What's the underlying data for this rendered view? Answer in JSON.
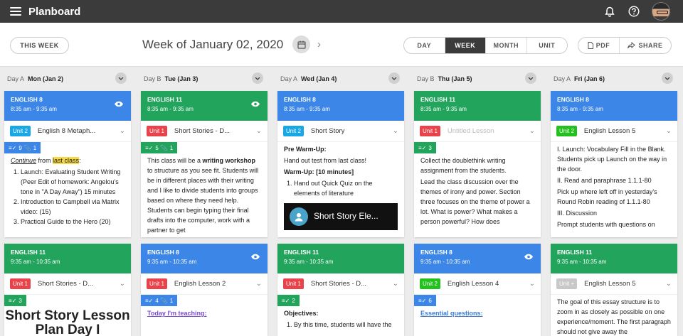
{
  "app": {
    "title": "Planboard"
  },
  "toolbar": {
    "this_week": "THIS WEEK",
    "week_title": "Week of January 02, 2020",
    "views": [
      "DAY",
      "WEEK",
      "MONTH",
      "UNIT"
    ],
    "active_view": "WEEK",
    "pdf": "PDF",
    "share": "SHARE"
  },
  "colors": {
    "blue": "#3b86e6",
    "green": "#22a45d",
    "red": "#e8434b",
    "unit_blue": "#1aa7e6",
    "unit_green": "#24c01d",
    "unit_gray": "#c8c8c8",
    "tab_blue": "#3b86e6",
    "tab_green": "#22a45d"
  },
  "days": [
    {
      "letter": "Day A",
      "name": "Mon (Jan 2)"
    },
    {
      "letter": "Day B",
      "name": "Tue (Jan 3)"
    },
    {
      "letter": "Day A",
      "name": "Wed (Jan 4)"
    },
    {
      "letter": "Day B",
      "name": "Thu (Jan 5)"
    },
    {
      "letter": "Day A",
      "name": "Fri (Jan 6)"
    }
  ],
  "cards": {
    "mon1": {
      "class": "ENGLISH 8",
      "time": "8:35 am - 9:35 am",
      "unit": "Unit 2",
      "lesson": "English 8 Metaph...",
      "checks": "9",
      "clips": "1",
      "intro_a": "Continue",
      "intro_b": " from ",
      "intro_c": "last class",
      "intro_d": ":",
      "items": [
        "Launch: Evaluating Student Writing (Peer Edit of homework: Angelou's tone in \"A Day Away\") 15 minutes",
        "Introduction to Campbell via Matrix video: (15)",
        "Practical Guide to the Hero (20)"
      ]
    },
    "tue1": {
      "class": "ENGLISH 11",
      "time": "8:35 am - 9:35 am",
      "unit": "Unit 1",
      "lesson": "Short Stories - D...",
      "checks": "5",
      "clips": "1",
      "text_a": "This class will be a ",
      "text_b": "writing workshop",
      "text_c": " to structure as you see fit. Students will be in different places with their writing and I like to divide students into groups based on where they need help. Students can begin typing their final drafts into the computer, work with a partner to get"
    },
    "wed1": {
      "class": "ENGLISH 8",
      "time": "8:35 am - 9:35 am",
      "unit": "Unit 2",
      "lesson": "Short Story",
      "h1": "Pre Warm-Up:",
      "p1": "Hand out test from last class!",
      "h2": "Warm-Up: [10 minutes]",
      "items": [
        "Hand out Quick Quiz on the elements of literature"
      ],
      "video": "Short Story Ele..."
    },
    "thu1": {
      "class": "ENGLISH 11",
      "time": "8:35 am - 9:35 am",
      "unit": "Unit 1",
      "lesson": "Untitled Lesson",
      "checks": "3",
      "p1": "Collect the doublethink writing assignment from the students.",
      "p2": "Lead the class discussion over the themes of irony and power. Section three focuses on the theme of power a lot. What is power? What makes a person powerful? How does"
    },
    "fri1": {
      "class": "ENGLISH 8",
      "time": "8:35 am - 9:35 am",
      "unit": "Unit 2",
      "lesson": "English Lesson 5",
      "p1": "I. Launch: Vocabulary Fill in the Blank. Students pick up Launch on the way in the door.",
      "p2": "II. Read and paraphrase 1.1.1-80",
      "p3": "Pick up where left off in yesterday's Round Robin reading of 1.1.1-80",
      "p4": "III. Discussion",
      "p5": "Prompt students with questions on"
    },
    "mon2": {
      "class": "ENGLISH 11",
      "time": "9:35 am - 10:35 am",
      "unit": "Unit 1",
      "lesson": "Short Stories - D...",
      "checks": "3",
      "big": "Short Story Lesson Plan Day I"
    },
    "tue2": {
      "class": "ENGLISH 8",
      "time": "9:35 am - 10:35 am",
      "unit": "Unit 1",
      "lesson": "English Lesson 2",
      "checks": "4",
      "clips": "1",
      "link": "Today I'm teaching:"
    },
    "wed2": {
      "class": "ENGLISH 11",
      "time": "9:35 am - 10:35 am",
      "unit": "Unit 1",
      "lesson": "Short Stories - D...",
      "checks": "2",
      "h1": "Objectives:",
      "items": [
        "By this time, students will have the"
      ]
    },
    "thu2": {
      "class": "ENGLISH 8",
      "time": "9:35 am - 10:35 am",
      "unit": "Unit 2",
      "lesson": "English Lesson 4",
      "checks": "6",
      "link": "Essential questions:"
    },
    "fri2": {
      "class": "ENGLISH 11",
      "time": "9:35 am - 10:35 am",
      "unit": "Unit",
      "lesson": "English Lesson 5",
      "p1": "The goal of this essay structure is to zoom in as closely as possible on one experience/moment. The first paragraph should not give away the"
    }
  }
}
